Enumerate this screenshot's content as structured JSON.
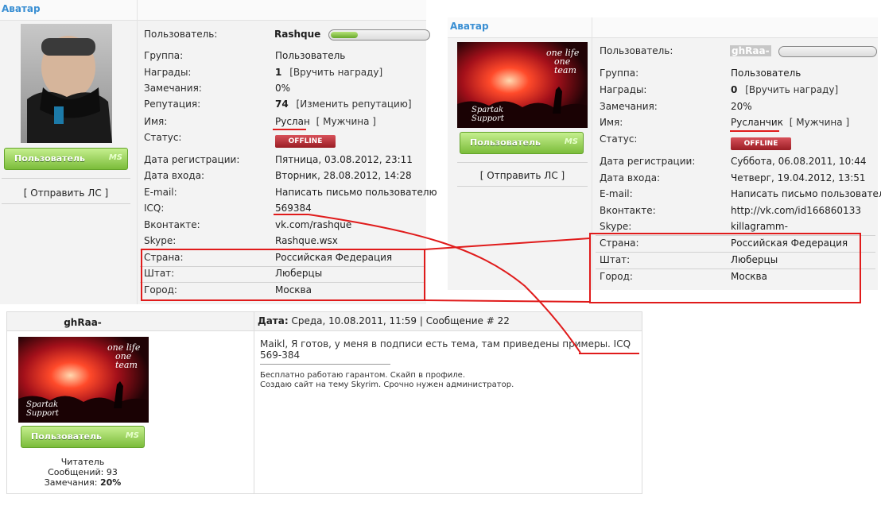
{
  "left_profile": {
    "avatar_header": "Аватар",
    "username": "Rashque",
    "rank_badge": "Пользователь",
    "rank_badge_brand": "MS",
    "send_pm": "[ Отправить ЛС ]",
    "progress": 0.3,
    "fields": [
      {
        "label": "Пользователь:",
        "value": ""
      },
      {
        "label": "Группа:",
        "value": "Пользователь"
      },
      {
        "label": "Награды:",
        "value": "1",
        "extra": "[Вручить награду]"
      },
      {
        "label": "Замечания:",
        "value": "0%"
      },
      {
        "label": "Репутация:",
        "value": "74",
        "extra": "[Изменить репутацию]"
      },
      {
        "label": "Имя:",
        "value": "Руслан",
        "extra": "[ Мужчина ]"
      },
      {
        "label": "Статус:",
        "value": "OFFLINE"
      },
      {
        "label": "Дата регистрации:",
        "value": "Пятница, 03.08.2012, 23:11"
      },
      {
        "label": "Дата входа:",
        "value": "Вторник, 28.08.2012, 14:28"
      },
      {
        "label": "E-mail:",
        "value": "Написать письмо пользователю"
      },
      {
        "label": "ICQ:",
        "value": "569384"
      },
      {
        "label": "Вконтакте:",
        "value": "vk.com/rashque"
      },
      {
        "label": "Skype:",
        "value": "Rashque.wsx"
      },
      {
        "label": "Страна:",
        "value": "Российская Федерация"
      },
      {
        "label": "Штат:",
        "value": "Люберцы"
      },
      {
        "label": "Город:",
        "value": "Москва"
      }
    ]
  },
  "right_profile": {
    "avatar_header": "Аватар",
    "username": "ghRaa-",
    "rank_badge": "Пользователь",
    "rank_badge_brand": "MS",
    "send_pm": "[ Отправить ЛС ]",
    "avatar_caption_1": "one life",
    "avatar_caption_2": "one team",
    "avatar_logo": "Spartak Support",
    "progress": 0.02,
    "fields": [
      {
        "label": "Пользователь:",
        "value": ""
      },
      {
        "label": "Группа:",
        "value": "Пользователь"
      },
      {
        "label": "Награды:",
        "value": "0",
        "extra": "[Вручить награду]"
      },
      {
        "label": "Замечания:",
        "value": "20%"
      },
      {
        "label": "Имя:",
        "value": "Русланчик",
        "extra": "[ Мужчина ]"
      },
      {
        "label": "Статус:",
        "value": "OFFLINE"
      },
      {
        "label": "Дата регистрации:",
        "value": "Суббота, 06.08.2011, 10:44"
      },
      {
        "label": "Дата входа:",
        "value": "Четверг, 19.04.2012, 13:51"
      },
      {
        "label": "E-mail:",
        "value": "Написать письмо пользователю"
      },
      {
        "label": "Вконтакте:",
        "value": "http://vk.com/id166860133"
      },
      {
        "label": "Skype:",
        "value": "killagramm-"
      },
      {
        "label": "Страна:",
        "value": "Российская Федерация"
      },
      {
        "label": "Штат:",
        "value": "Люберцы"
      },
      {
        "label": "Город:",
        "value": "Москва"
      }
    ]
  },
  "post": {
    "author": "ghRaa-",
    "date_prefix": "Дата:",
    "date_value": "Среда, 10.08.2011, 11:59",
    "message_prefix": "| Сообщение #",
    "message_number": "22",
    "message_text": "Maikl, Я готов, у меня в подписи есть тема, там приведены примеры. ICQ 569-384",
    "signature_line1": "Бесплатно работаю гарантом. Скайп в профиле.",
    "signature_line2": "Создаю сайт на тему Skyrim. Срочно нужен администратор.",
    "rank_badge": "Пользователь",
    "rank_badge_brand": "MS",
    "avatar_caption_1": "one life",
    "avatar_caption_2": "one team",
    "avatar_logo": "Spartak Support",
    "stat_role": "Читатель",
    "stat_messages_label": "Сообщений:",
    "stat_messages_value": "93",
    "stat_warnings_label": "Замечания:",
    "stat_warnings_value": "20%"
  },
  "colors": {
    "accent_blue": "#3a8fd3",
    "annotation_red": "#e01b1b",
    "badge_green": "#7bbc3a",
    "offline_red": "#b82f37"
  }
}
